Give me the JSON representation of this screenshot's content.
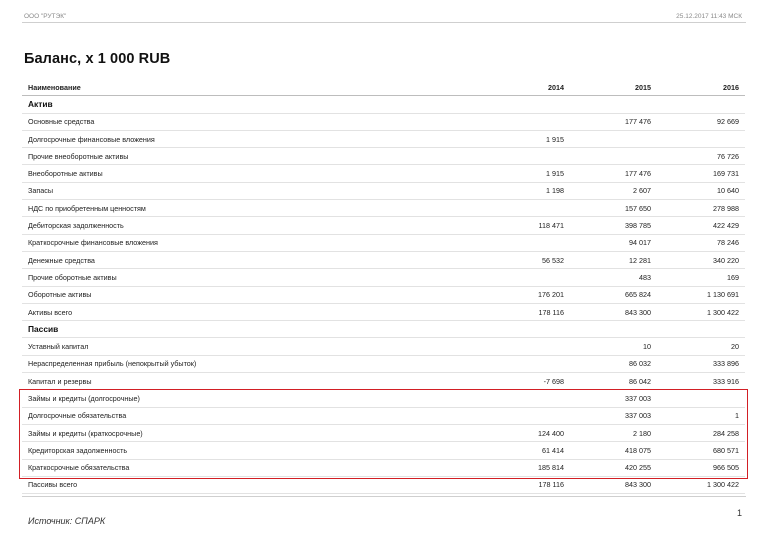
{
  "header": {
    "company": "ООО \"РУТЭК\"",
    "datetime": "25.12.2017 11:43 МСК"
  },
  "title": "Баланс, x 1 000 RUB",
  "table": {
    "columns": [
      "Наименование",
      "2014",
      "2015",
      "2016"
    ],
    "rows": [
      {
        "type": "section",
        "name": "Актив",
        "values": [
          "",
          "",
          ""
        ]
      },
      {
        "type": "row",
        "name": "Основные средства",
        "values": [
          "",
          "177 476",
          "92 669"
        ]
      },
      {
        "type": "row",
        "name": "Долгосрочные финансовые вложения",
        "values": [
          "1 915",
          "",
          ""
        ]
      },
      {
        "type": "row",
        "name": "Прочие внеоборотные активы",
        "values": [
          "",
          "",
          "76 726"
        ]
      },
      {
        "type": "row",
        "name": "Внеоборотные активы",
        "values": [
          "1 915",
          "177 476",
          "169 731"
        ]
      },
      {
        "type": "row",
        "name": "Запасы",
        "values": [
          "1 198",
          "2 607",
          "10 640"
        ]
      },
      {
        "type": "row",
        "name": "НДС по приобретенным ценностям",
        "values": [
          "",
          "157 650",
          "278 988"
        ]
      },
      {
        "type": "row",
        "name": "Дебиторская задолженность",
        "values": [
          "118 471",
          "398 785",
          "422 429"
        ]
      },
      {
        "type": "row",
        "name": "Краткосрочные финансовые вложения",
        "values": [
          "",
          "94 017",
          "78 246"
        ]
      },
      {
        "type": "row",
        "name": "Денежные средства",
        "values": [
          "56 532",
          "12 281",
          "340 220"
        ]
      },
      {
        "type": "row",
        "name": "Прочие оборотные активы",
        "values": [
          "",
          "483",
          "169"
        ]
      },
      {
        "type": "row",
        "name": "Оборотные активы",
        "values": [
          "176 201",
          "665 824",
          "1 130 691"
        ]
      },
      {
        "type": "row",
        "name": "Активы всего",
        "values": [
          "178 116",
          "843 300",
          "1 300 422"
        ]
      },
      {
        "type": "section",
        "name": "Пассив",
        "values": [
          "",
          "",
          ""
        ]
      },
      {
        "type": "row",
        "name": "Уставный капитал",
        "values": [
          "",
          "10",
          "20"
        ]
      },
      {
        "type": "row",
        "name": "Нераспределенная прибыль (непокрытый убыток)",
        "values": [
          "",
          "86 032",
          "333 896"
        ]
      },
      {
        "type": "row",
        "name": "Капитал и резервы",
        "values": [
          "-7 698",
          "86 042",
          "333 916"
        ]
      },
      {
        "type": "row",
        "name": "Займы и кредиты (долгосрочные)",
        "values": [
          "",
          "337 003",
          ""
        ]
      },
      {
        "type": "row",
        "name": "Долгосрочные обязательства",
        "values": [
          "",
          "337 003",
          "1"
        ]
      },
      {
        "type": "row",
        "name": "Займы и кредиты (краткосрочные)",
        "values": [
          "124 400",
          "2 180",
          "284 258"
        ]
      },
      {
        "type": "row",
        "name": "Кредиторская задолженность",
        "values": [
          "61 414",
          "418 075",
          "680 571"
        ]
      },
      {
        "type": "row",
        "name": "Краткосрочные обязательства",
        "values": [
          "185 814",
          "420 255",
          "966 505"
        ]
      },
      {
        "type": "row",
        "name": "Пассивы всего",
        "values": [
          "178 116",
          "843 300",
          "1 300 422"
        ]
      }
    ]
  },
  "footer": {
    "source": "Источник: СПАРК",
    "page": "1"
  },
  "colors": {
    "highlight_border": "#d21f25"
  }
}
